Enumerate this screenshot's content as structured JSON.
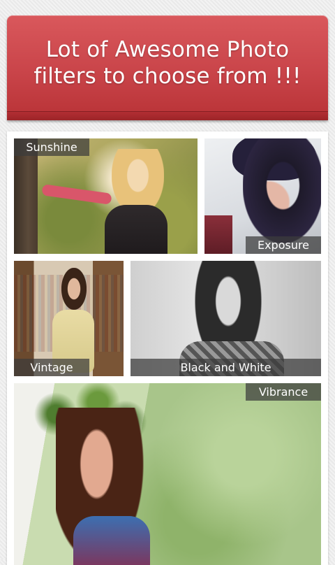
{
  "banner": {
    "title": "Lot of Awesome Photo\nfilters to choose from !!!"
  },
  "filters": [
    {
      "label": "Sunshine"
    },
    {
      "label": "Exposure"
    },
    {
      "label": "Vintage"
    },
    {
      "label": "Black and White"
    },
    {
      "label": "Vibrance"
    }
  ],
  "colors": {
    "banner": "#c94449",
    "label_background": "#3c3c3c",
    "page_background": "#ededed"
  }
}
